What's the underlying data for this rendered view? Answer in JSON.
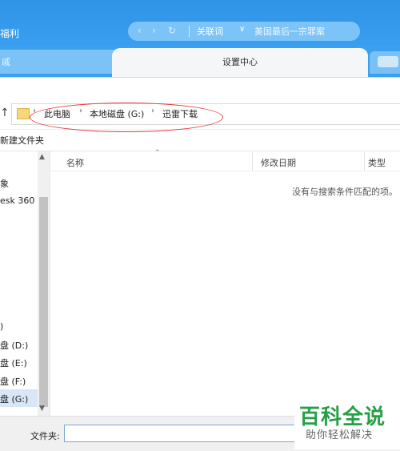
{
  "browser": {
    "top_left_text": "福利",
    "nav_back": "‹",
    "nav_forward": "›",
    "nav_refresh": "↻",
    "related_label": "关联词",
    "query": "美国最后一宗罪案",
    "tabs": [
      {
        "label": "戚"
      },
      {
        "label": "设置中心"
      }
    ]
  },
  "dialog": {
    "up_button": "↑",
    "breadcrumb": [
      "此电脑",
      "本地磁盘 (G:)",
      "迅雷下载"
    ],
    "breadcrumb_sep": "›",
    "new_folder": "新建文件夹",
    "nav_items": [
      {
        "label": "象"
      },
      {
        "label": "esk 360"
      },
      {
        "label": ")"
      },
      {
        "label": "盘 (D:)"
      },
      {
        "label": "盘 (E:)"
      },
      {
        "label": "盘 (F:)"
      },
      {
        "label": "盘 (G:)"
      }
    ],
    "columns": {
      "name": "名称",
      "date": "修改日期",
      "type": "类型"
    },
    "empty_message": "没有与搜索条件匹配的项。",
    "filename_label": "文件夹:",
    "filename_value": ""
  },
  "watermark": {
    "title": "百科全说",
    "subtitle": "助你轻松解决"
  },
  "colors": {
    "accent": "#3a9ff0",
    "highlight": "#e53a3a",
    "watermark": "#25a046"
  }
}
